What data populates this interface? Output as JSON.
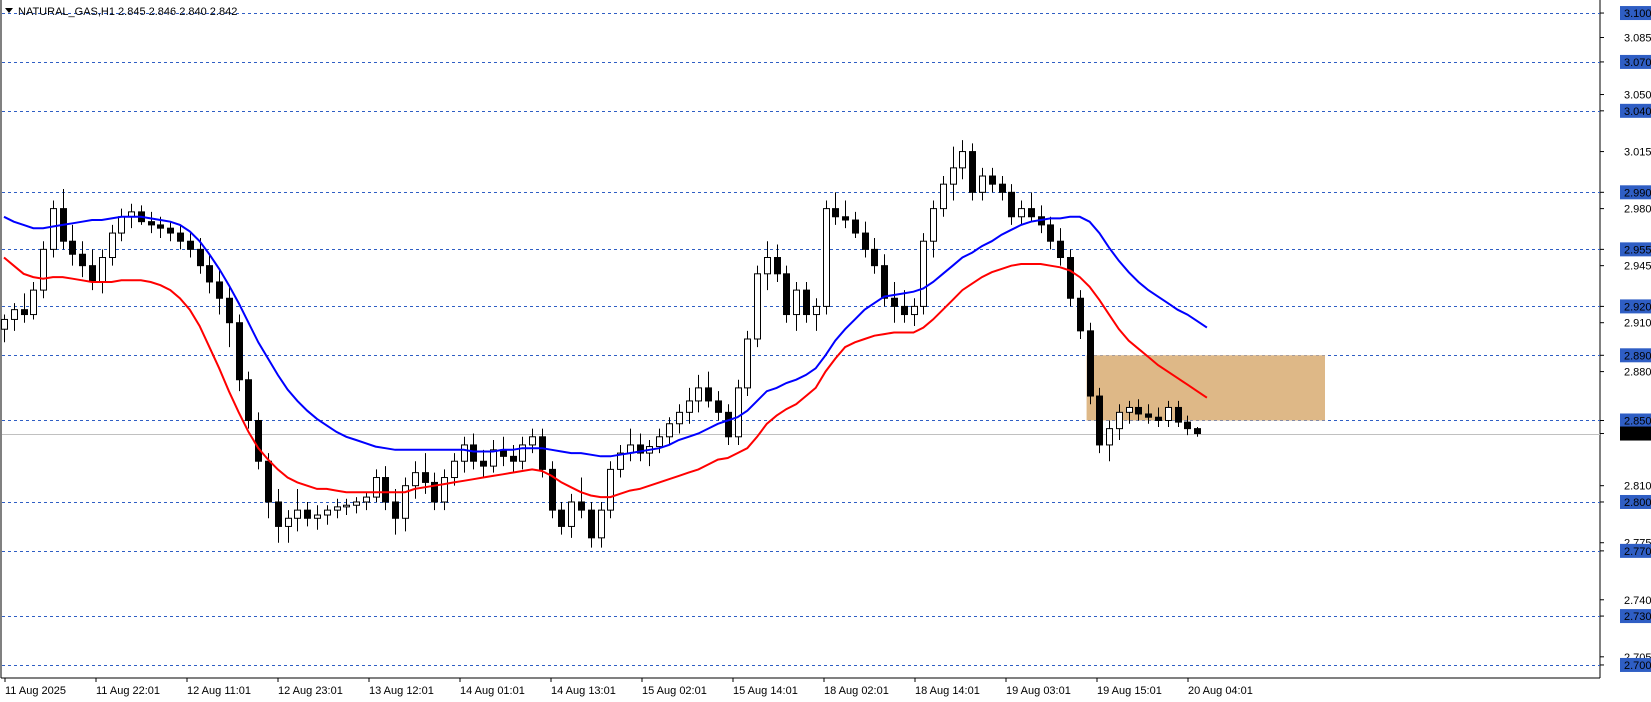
{
  "chart_data": {
    "type": "candlestick",
    "symbol_line": "NATURAL_GAS,H1  2.845 2.846 2.840 2.842",
    "current_price": 2.842,
    "y_range": [
      2.692,
      3.108
    ],
    "y_ticks": [
      "3.100",
      "3.085",
      "3.070",
      "3.050",
      "3.040",
      "3.015",
      "2.990",
      "2.980",
      "2.955",
      "2.945",
      "2.920",
      "2.910",
      "2.890",
      "2.880",
      "2.850",
      "2.842",
      "2.810",
      "2.800",
      "2.775",
      "2.770",
      "2.740",
      "2.730",
      "2.705",
      "2.700"
    ],
    "level_lines": [
      3.1,
      3.07,
      3.04,
      2.99,
      2.955,
      2.92,
      2.89,
      2.85,
      2.8,
      2.77,
      2.73,
      2.7
    ],
    "x_labels": [
      "11 Aug 2025",
      "11 Aug 22:01",
      "12 Aug 11:01",
      "12 Aug 23:01",
      "13 Aug 12:01",
      "14 Aug 01:01",
      "14 Aug 13:01",
      "15 Aug 02:01",
      "15 Aug 14:01",
      "18 Aug 02:01",
      "18 Aug 14:01",
      "19 Aug 03:01",
      "19 Aug 15:01",
      "20 Aug 04:01"
    ],
    "zone": {
      "top": 2.89,
      "bottom": 2.85,
      "color": "#deb887"
    },
    "colors": {
      "grid": "#2f5ec4",
      "bull": "#ffffff",
      "bear": "#000000",
      "ma_fast": "#ff0000",
      "ma_slow": "#0000ff",
      "label_bg": "#2f5ec4",
      "price_bg": "#000000"
    },
    "candles": [
      [
        2.906,
        2.915,
        2.898,
        2.912
      ],
      [
        2.912,
        2.922,
        2.905,
        2.918
      ],
      [
        2.918,
        2.928,
        2.91,
        2.915
      ],
      [
        2.915,
        2.935,
        2.912,
        2.93
      ],
      [
        2.93,
        2.96,
        2.925,
        2.955
      ],
      [
        2.955,
        2.985,
        2.95,
        2.98
      ],
      [
        2.98,
        2.992,
        2.955,
        2.96
      ],
      [
        2.96,
        2.97,
        2.945,
        2.952
      ],
      [
        2.952,
        2.96,
        2.938,
        2.945
      ],
      [
        2.945,
        2.955,
        2.93,
        2.935
      ],
      [
        2.935,
        2.955,
        2.928,
        2.95
      ],
      [
        2.95,
        2.97,
        2.945,
        2.965
      ],
      [
        2.965,
        2.98,
        2.96,
        2.975
      ],
      [
        2.975,
        2.983,
        2.968,
        2.978
      ],
      [
        2.978,
        2.982,
        2.97,
        2.972
      ],
      [
        2.972,
        2.978,
        2.965,
        2.97
      ],
      [
        2.97,
        2.975,
        2.962,
        2.968
      ],
      [
        2.968,
        2.972,
        2.96,
        2.965
      ],
      [
        2.965,
        2.97,
        2.955,
        2.96
      ],
      [
        2.96,
        2.965,
        2.95,
        2.955
      ],
      [
        2.955,
        2.962,
        2.94,
        2.945
      ],
      [
        2.945,
        2.952,
        2.928,
        2.935
      ],
      [
        2.935,
        2.942,
        2.915,
        2.925
      ],
      [
        2.925,
        2.932,
        2.895,
        2.91
      ],
      [
        2.91,
        2.915,
        2.868,
        2.875
      ],
      [
        2.875,
        2.88,
        2.845,
        2.85
      ],
      [
        2.85,
        2.855,
        2.82,
        2.825
      ],
      [
        2.825,
        2.83,
        2.79,
        2.8
      ],
      [
        2.8,
        2.808,
        2.775,
        2.785
      ],
      [
        2.785,
        2.795,
        2.775,
        2.79
      ],
      [
        2.79,
        2.808,
        2.782,
        2.795
      ],
      [
        2.795,
        2.8,
        2.785,
        2.79
      ],
      [
        2.79,
        2.798,
        2.783,
        2.792
      ],
      [
        2.792,
        2.798,
        2.786,
        2.795
      ],
      [
        2.795,
        2.802,
        2.79,
        2.797
      ],
      [
        2.797,
        2.802,
        2.792,
        2.798
      ],
      [
        2.798,
        2.803,
        2.793,
        2.8
      ],
      [
        2.8,
        2.806,
        2.795,
        2.803
      ],
      [
        2.803,
        2.82,
        2.8,
        2.815
      ],
      [
        2.815,
        2.822,
        2.795,
        2.8
      ],
      [
        2.8,
        2.808,
        2.78,
        2.79
      ],
      [
        2.79,
        2.815,
        2.782,
        2.81
      ],
      [
        2.81,
        2.825,
        2.802,
        2.818
      ],
      [
        2.818,
        2.83,
        2.805,
        2.812
      ],
      [
        2.812,
        2.818,
        2.795,
        2.8
      ],
      [
        2.8,
        2.82,
        2.795,
        2.815
      ],
      [
        2.815,
        2.83,
        2.81,
        2.825
      ],
      [
        2.825,
        2.84,
        2.818,
        2.835
      ],
      [
        2.835,
        2.842,
        2.82,
        2.825
      ],
      [
        2.825,
        2.832,
        2.815,
        2.822
      ],
      [
        2.822,
        2.838,
        2.818,
        2.832
      ],
      [
        2.832,
        2.84,
        2.822,
        2.828
      ],
      [
        2.828,
        2.835,
        2.818,
        2.825
      ],
      [
        2.825,
        2.84,
        2.82,
        2.835
      ],
      [
        2.835,
        2.845,
        2.83,
        2.84
      ],
      [
        2.84,
        2.845,
        2.815,
        2.82
      ],
      [
        2.82,
        2.825,
        2.79,
        2.795
      ],
      [
        2.795,
        2.8,
        2.78,
        2.785
      ],
      [
        2.785,
        2.805,
        2.778,
        2.8
      ],
      [
        2.8,
        2.815,
        2.79,
        2.795
      ],
      [
        2.795,
        2.8,
        2.772,
        2.778
      ],
      [
        2.778,
        2.8,
        2.772,
        2.795
      ],
      [
        2.795,
        2.825,
        2.79,
        2.82
      ],
      [
        2.82,
        2.835,
        2.815,
        2.83
      ],
      [
        2.83,
        2.845,
        2.825,
        2.835
      ],
      [
        2.835,
        2.842,
        2.825,
        2.83
      ],
      [
        2.83,
        2.838,
        2.822,
        2.834
      ],
      [
        2.834,
        2.845,
        2.83,
        2.84
      ],
      [
        2.84,
        2.852,
        2.835,
        2.848
      ],
      [
        2.848,
        2.86,
        2.842,
        2.855
      ],
      [
        2.855,
        2.87,
        2.848,
        2.862
      ],
      [
        2.862,
        2.878,
        2.855,
        2.87
      ],
      [
        2.87,
        2.88,
        2.858,
        2.862
      ],
      [
        2.862,
        2.868,
        2.85,
        2.855
      ],
      [
        2.855,
        2.86,
        2.835,
        2.84
      ],
      [
        2.84,
        2.875,
        2.835,
        2.87
      ],
      [
        2.87,
        2.905,
        2.865,
        2.9
      ],
      [
        2.9,
        2.945,
        2.895,
        2.94
      ],
      [
        2.94,
        2.96,
        2.93,
        2.95
      ],
      [
        2.95,
        2.958,
        2.935,
        2.94
      ],
      [
        2.94,
        2.945,
        2.91,
        2.915
      ],
      [
        2.915,
        2.935,
        2.905,
        2.93
      ],
      [
        2.93,
        2.935,
        2.91,
        2.915
      ],
      [
        2.915,
        2.925,
        2.905,
        2.92
      ],
      [
        2.92,
        2.985,
        2.915,
        2.98
      ],
      [
        2.98,
        2.99,
        2.97,
        2.975
      ],
      [
        2.975,
        2.985,
        2.968,
        2.973
      ],
      [
        2.973,
        2.978,
        2.962,
        2.965
      ],
      [
        2.965,
        2.972,
        2.95,
        2.955
      ],
      [
        2.955,
        2.962,
        2.94,
        2.945
      ],
      [
        2.945,
        2.952,
        2.92,
        2.925
      ],
      [
        2.925,
        2.935,
        2.91,
        2.92
      ],
      [
        2.92,
        2.93,
        2.91,
        2.915
      ],
      [
        2.915,
        2.925,
        2.908,
        2.92
      ],
      [
        2.92,
        2.965,
        2.915,
        2.96
      ],
      [
        2.96,
        2.985,
        2.95,
        2.98
      ],
      [
        2.98,
        3.0,
        2.975,
        2.995
      ],
      [
        2.995,
        3.018,
        2.985,
        3.005
      ],
      [
        3.005,
        3.022,
        2.998,
        3.015
      ],
      [
        3.015,
        3.02,
        2.985,
        2.99
      ],
      [
        2.99,
        3.005,
        2.985,
        3.0
      ],
      [
        3.0,
        3.005,
        2.99,
        2.995
      ],
      [
        2.995,
        3.0,
        2.985,
        2.99
      ],
      [
        2.99,
        2.995,
        2.97,
        2.975
      ],
      [
        2.975,
        2.985,
        2.97,
        2.98
      ],
      [
        2.98,
        2.99,
        2.972,
        2.975
      ],
      [
        2.975,
        2.982,
        2.965,
        2.97
      ],
      [
        2.97,
        2.975,
        2.955,
        2.96
      ],
      [
        2.96,
        2.968,
        2.945,
        2.95
      ],
      [
        2.95,
        2.955,
        2.92,
        2.925
      ],
      [
        2.925,
        2.93,
        2.9,
        2.905
      ],
      [
        2.905,
        2.91,
        2.86,
        2.865
      ],
      [
        2.865,
        2.87,
        2.83,
        2.835
      ],
      [
        2.835,
        2.85,
        2.825,
        2.845
      ],
      [
        2.845,
        2.86,
        2.838,
        2.855
      ],
      [
        2.855,
        2.862,
        2.848,
        2.858
      ],
      [
        2.858,
        2.863,
        2.85,
        2.854
      ],
      [
        2.854,
        2.86,
        2.848,
        2.852
      ],
      [
        2.852,
        2.858,
        2.846,
        2.85
      ],
      [
        2.85,
        2.862,
        2.846,
        2.858
      ],
      [
        2.858,
        2.862,
        2.846,
        2.849
      ],
      [
        2.849,
        2.853,
        2.841,
        2.845
      ],
      [
        2.845,
        2.846,
        2.84,
        2.842
      ]
    ],
    "ma_fast": [
      2.95,
      2.945,
      2.94,
      2.938,
      2.937,
      2.938,
      2.938,
      2.937,
      2.936,
      2.935,
      2.935,
      2.935,
      2.936,
      2.936,
      2.936,
      2.935,
      2.933,
      2.93,
      2.925,
      2.918,
      2.908,
      2.895,
      2.882,
      2.868,
      2.855,
      2.843,
      2.833,
      2.826,
      2.82,
      2.815,
      2.812,
      2.81,
      2.808,
      2.808,
      2.807,
      2.806,
      2.806,
      2.806,
      2.806,
      2.806,
      2.806,
      2.806,
      2.808,
      2.809,
      2.81,
      2.811,
      2.812,
      2.813,
      2.814,
      2.815,
      2.816,
      2.817,
      2.818,
      2.819,
      2.82,
      2.819,
      2.816,
      2.812,
      2.809,
      2.806,
      2.804,
      2.803,
      2.803,
      2.805,
      2.807,
      2.808,
      2.81,
      2.812,
      2.814,
      2.816,
      2.818,
      2.82,
      2.823,
      2.826,
      2.827,
      2.83,
      2.833,
      2.84,
      2.848,
      2.853,
      2.857,
      2.86,
      2.865,
      2.87,
      2.88,
      2.888,
      2.895,
      2.898,
      2.9,
      2.902,
      2.903,
      2.904,
      2.904,
      2.904,
      2.907,
      2.912,
      2.918,
      2.924,
      2.93,
      2.934,
      2.938,
      2.941,
      2.943,
      2.945,
      2.946,
      2.946,
      2.946,
      2.945,
      2.944,
      2.942,
      2.938,
      2.932,
      2.924,
      2.915,
      2.906,
      2.899,
      2.894,
      2.889,
      2.884,
      2.88,
      2.876,
      2.872,
      2.868,
      2.864
    ],
    "ma_slow": [
      2.975,
      2.972,
      2.97,
      2.968,
      2.968,
      2.969,
      2.97,
      2.971,
      2.972,
      2.973,
      2.973,
      2.974,
      2.975,
      2.975,
      2.975,
      2.974,
      2.973,
      2.972,
      2.97,
      2.966,
      2.96,
      2.952,
      2.943,
      2.933,
      2.922,
      2.91,
      2.898,
      2.888,
      2.878,
      2.869,
      2.862,
      2.856,
      2.851,
      2.847,
      2.843,
      2.84,
      2.838,
      2.836,
      2.834,
      2.833,
      2.832,
      2.832,
      2.832,
      2.832,
      2.832,
      2.832,
      2.832,
      2.832,
      2.831,
      2.831,
      2.831,
      2.832,
      2.832,
      2.833,
      2.833,
      2.833,
      2.832,
      2.831,
      2.83,
      2.83,
      2.829,
      2.828,
      2.828,
      2.829,
      2.83,
      2.831,
      2.832,
      2.833,
      2.835,
      2.838,
      2.84,
      2.842,
      2.845,
      2.848,
      2.85,
      2.852,
      2.856,
      2.862,
      2.868,
      2.87,
      2.873,
      2.875,
      2.878,
      2.882,
      2.89,
      2.899,
      2.906,
      2.912,
      2.918,
      2.922,
      2.926,
      2.927,
      2.928,
      2.929,
      2.931,
      2.935,
      2.94,
      2.945,
      2.95,
      2.953,
      2.957,
      2.96,
      2.964,
      2.967,
      2.97,
      2.972,
      2.973,
      2.974,
      2.974,
      2.975,
      2.975,
      2.972,
      2.965,
      2.956,
      2.948,
      2.941,
      2.935,
      2.93,
      2.926,
      2.922,
      2.918,
      2.915,
      2.911,
      2.907
    ]
  }
}
